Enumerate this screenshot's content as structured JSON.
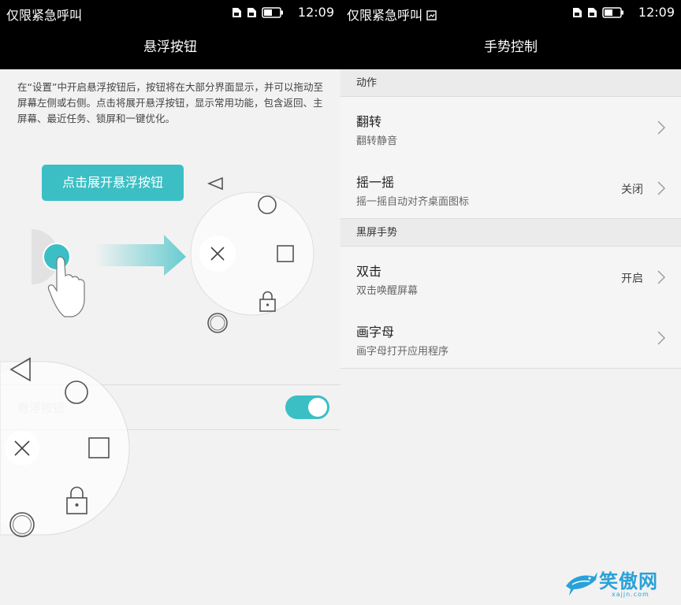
{
  "left": {
    "status": {
      "carrier": "仅限紧急呼叫",
      "time": "12:09"
    },
    "title": "悬浮按钮",
    "description": "在“设置”中开启悬浮按钮后，按钮将在大部分界面显示，并可以拖动至屏幕左侧或右侧。点击将展开悬浮按钮，显示常用功能，包含返回、主屏幕、最近任务、锁屏和一键优化。",
    "tap_label": "点击展开悬浮按钮",
    "setting": {
      "label": "悬浮按钮",
      "enabled": true
    },
    "colors": {
      "accent": "#3bbfc4"
    }
  },
  "right": {
    "status": {
      "carrier": "仅限紧急呼叫",
      "time": "12:09"
    },
    "title": "手势控制",
    "sections": [
      {
        "header": "动作",
        "items": [
          {
            "title": "翻转",
            "subtitle": "翻转静音",
            "status": ""
          },
          {
            "title": "摇一摇",
            "subtitle": "摇一摇自动对齐桌面图标",
            "status": "关闭"
          }
        ]
      },
      {
        "header": "黑屏手势",
        "items": [
          {
            "title": "双击",
            "subtitle": "双击唤醒屏幕",
            "status": "开启"
          },
          {
            "title": "画字母",
            "subtitle": "画字母打开应用程序",
            "status": ""
          }
        ]
      }
    ]
  },
  "watermark": {
    "text": "笑傲网",
    "sub": "xajjn.com"
  }
}
